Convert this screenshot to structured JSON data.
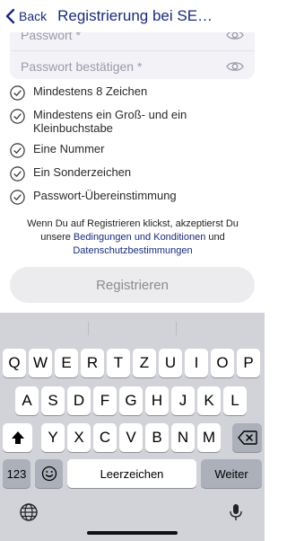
{
  "header": {
    "back_label": "Back",
    "title": "Registrierung bei SEC..."
  },
  "form": {
    "password_placeholder": "Passwort *",
    "confirm_placeholder": "Passwort bestätigen *"
  },
  "requirements": [
    "Mindestens 8 Zeichen",
    "Mindestens ein Groß- und ein Kleinbuchstabe",
    "Eine Nummer",
    "Ein Sonderzeichen",
    "Passwort-Übereinstimmung"
  ],
  "terms": {
    "text_before": "Wenn Du auf Registrieren klickst, akzeptierst Du unsere",
    "link1": "Bedingungen und Konditionen",
    "text_middle": "und",
    "link2": "Datenschutzbestimmungen"
  },
  "register_label": "Registrieren",
  "keyboard": {
    "row1": [
      "Q",
      "W",
      "E",
      "R",
      "T",
      "Z",
      "U",
      "I",
      "O",
      "P"
    ],
    "row2": [
      "A",
      "S",
      "D",
      "F",
      "G",
      "H",
      "J",
      "K",
      "L"
    ],
    "row3": [
      "Y",
      "X",
      "C",
      "V",
      "B",
      "N",
      "M"
    ],
    "numbers_label": "123",
    "space_label": "Leerzeichen",
    "return_label": "Weiter"
  },
  "icons": {
    "back": "chevron-left-icon",
    "eye": "eye-icon",
    "check": "check-circle-icon",
    "shift": "shift-icon",
    "delete": "delete-icon",
    "emoji": "emoji-icon",
    "globe": "globe-icon",
    "mic": "microphone-icon"
  },
  "colors": {
    "accent": "#1a2a7a",
    "button_bg": "#ececee",
    "keyboard_bg": "#d1d3d9"
  }
}
